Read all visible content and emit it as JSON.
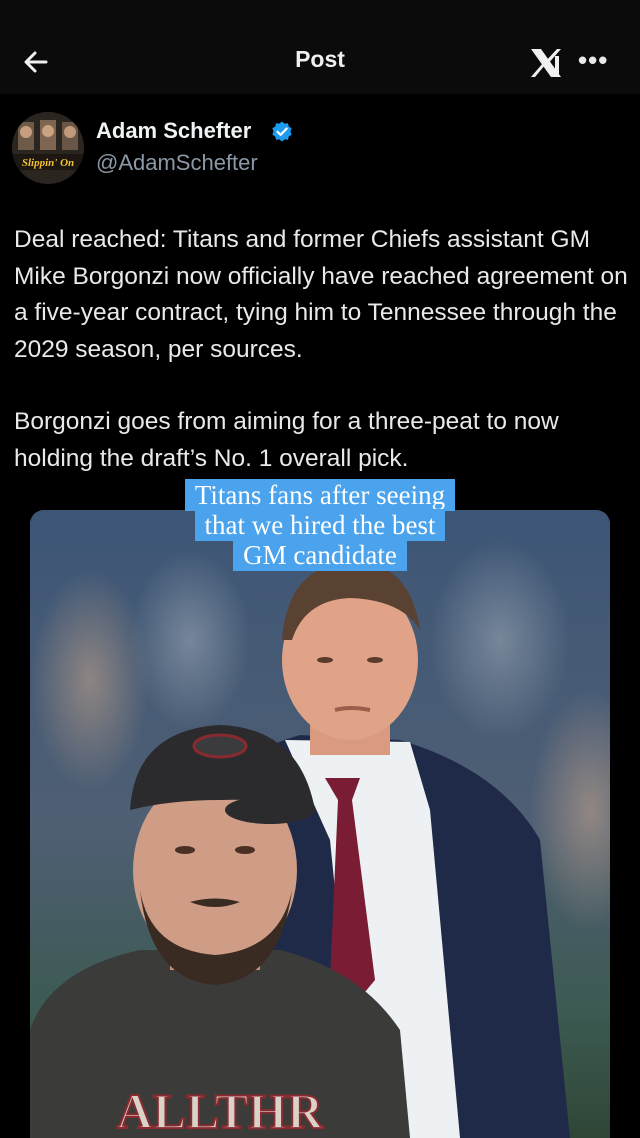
{
  "header": {
    "title": "Post",
    "back_icon": "arrow-left-icon",
    "logo_icon": "x-logo-icon",
    "more_icon": "more-horizontal-icon",
    "more_label": "•••"
  },
  "author": {
    "name": "Adam Schefter",
    "handle": "@AdamSchefter",
    "verified_color": "#1d9bf0",
    "avatar_logo_text": "Slippin' On"
  },
  "post": {
    "paragraphs": [
      "Deal reached: Titans and former Chiefs assistant GM Mike Borgonzi now officially have reached agreement on a five-year contract, tying him to Tennessee through the 2029 season, per sources.",
      "Borgonzi goes from aiming for a three-peat to now holding the draft’s No. 1 overall pick."
    ]
  },
  "overlay": {
    "caption_lines": [
      "Titans fans after seeing",
      "that we hired the best",
      "GM candidate"
    ],
    "caption_bg": "#4aa3ec",
    "shirt_text": "ALLTHR"
  },
  "colors": {
    "background": "#000000",
    "text": "#e7e9ea",
    "secondary_text": "#8b98a5"
  }
}
